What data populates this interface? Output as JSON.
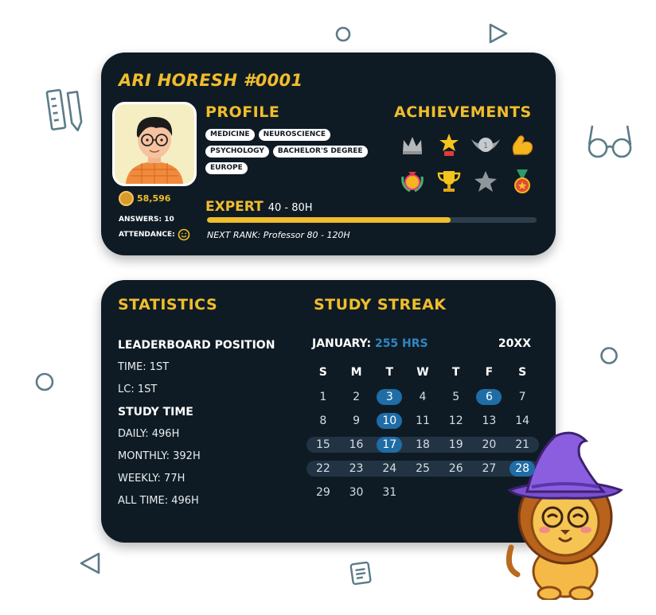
{
  "profile": {
    "name": "ARI HORESH #0001",
    "section_title": "PROFILE",
    "tags": [
      "MEDICINE",
      "NEUROSCIENCE",
      "PSYCHOLOGY",
      "BACHELOR'S DEGREE",
      "EUROPE"
    ],
    "coins": "58,596",
    "answers": "ANSWERS: 10",
    "attendance": "ATTENDANCE:",
    "rank": "EXPERT",
    "rank_range": "40 - 80H",
    "progress": 0.74,
    "next_rank": "NEXT RANK: Professor 80 - 120H"
  },
  "achievements": {
    "title": "ACHIEVEMENTS",
    "badges": [
      "crown-icon",
      "star-trophy-icon",
      "winged-medal-icon",
      "flexed-arm-icon",
      "laurel-medal-icon",
      "trophy-icon",
      "silver-star-icon",
      "ribbon-medal-icon"
    ]
  },
  "statistics": {
    "title": "STATISTICS",
    "leaderboard_heading": "LEADERBOARD POSITION",
    "time": "TIME: 1ST",
    "lc": "LC: 1ST",
    "study_time_heading": "STUDY TIME",
    "daily": "DAILY: 496H",
    "monthly": "MONTHLY: 392H",
    "weekly": "WEEKLY:  77H",
    "all_time": "ALL TIME: 496H"
  },
  "streak": {
    "title": "STUDY STREAK",
    "month": "JANUARY:",
    "hours": "255 HRS",
    "year": "20XX",
    "weekdays": [
      "S",
      "M",
      "T",
      "W",
      "T",
      "F",
      "S"
    ],
    "weeks": [
      [
        "1",
        "2",
        "3",
        "4",
        "5",
        "6",
        "7"
      ],
      [
        "8",
        "9",
        "10",
        "11",
        "12",
        "13",
        "14"
      ],
      [
        "15",
        "16",
        "17",
        "18",
        "19",
        "20",
        "21"
      ],
      [
        "22",
        "23",
        "24",
        "25",
        "26",
        "27",
        "28"
      ],
      [
        "29",
        "30",
        "31",
        "",
        "",
        "",
        ""
      ]
    ],
    "highlighted_days": [
      "3",
      "6",
      "10",
      "17",
      "28"
    ],
    "colors": {
      "accent": "#f0bd2c",
      "highlight": "#1f6da6",
      "card": "#0f1b24"
    }
  }
}
